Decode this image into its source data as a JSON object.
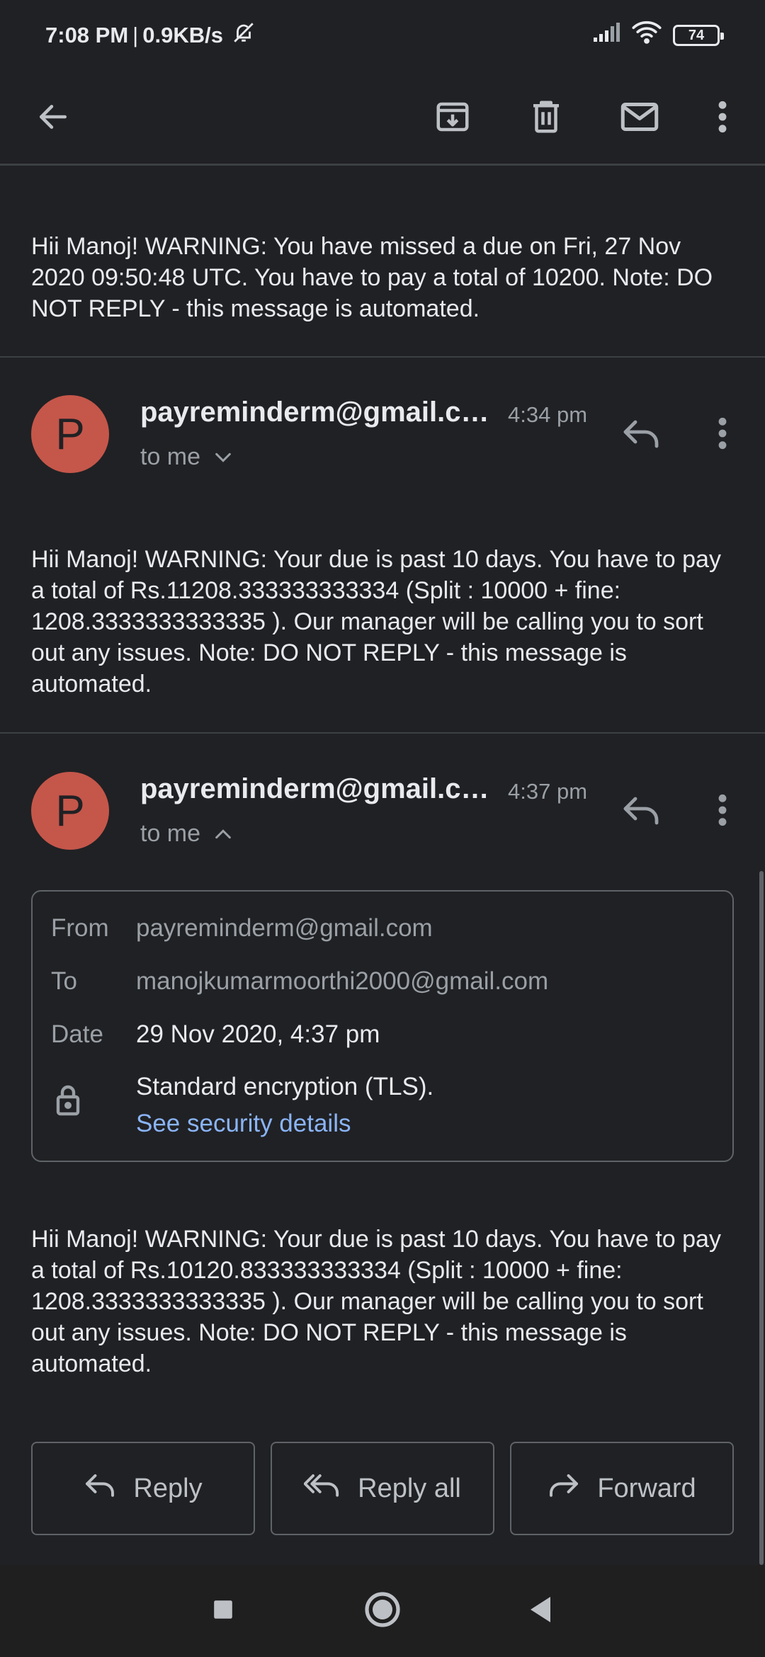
{
  "status_bar": {
    "time": "7:08 PM",
    "speed": "0.9KB/s",
    "battery": "74"
  },
  "toolbar": {
    "back_icon": "arrow-back-icon",
    "archive_icon": "archive-icon",
    "delete_icon": "trash-icon",
    "unread_icon": "mail-icon",
    "more_icon": "more-vert-icon"
  },
  "messages": [
    {
      "body": "Hii Manoj! WARNING: You have missed a due on Fri, 27 Nov 2020 09:50:48 UTC. You have to pay a total of 10200. Note: DO NOT REPLY - this message is automated."
    },
    {
      "avatar_letter": "P",
      "sender": "payreminderm@gmail.com",
      "time": "4:34 pm",
      "to": "to me",
      "body": "Hii Manoj! WARNING: Your due is past 10 days. You have to pay a total of Rs.11208.333333333334 (Split : 10000 + fine: 1208.3333333333335 ). Our manager will be calling you to sort out any issues. Note: DO NOT REPLY - this message is automated."
    },
    {
      "avatar_letter": "P",
      "sender": "payreminderm@gmail.com",
      "time": "4:37 pm",
      "to": "to me",
      "details": {
        "from_label": "From",
        "from_value": "payreminderm@gmail.com",
        "to_label": "To",
        "to_value": "manojkumarmoorthi2000@gmail.com",
        "date_label": "Date",
        "date_value": "29 Nov 2020, 4:37 pm",
        "encryption": "Standard encryption (TLS).",
        "security_link": "See security details"
      },
      "body": "Hii Manoj! WARNING: Your due is past 10 days. You have to pay a total of Rs.10120.833333333334 (Split : 10000 + fine: 1208.3333333333335 ). Our manager will be calling you to sort out any issues. Note: DO NOT REPLY - this message is automated."
    }
  ],
  "actions": {
    "reply": "Reply",
    "reply_all": "Reply all",
    "forward": "Forward"
  },
  "colors": {
    "background": "#202124",
    "avatar": "#c5564a",
    "link": "#8ab4f8"
  }
}
